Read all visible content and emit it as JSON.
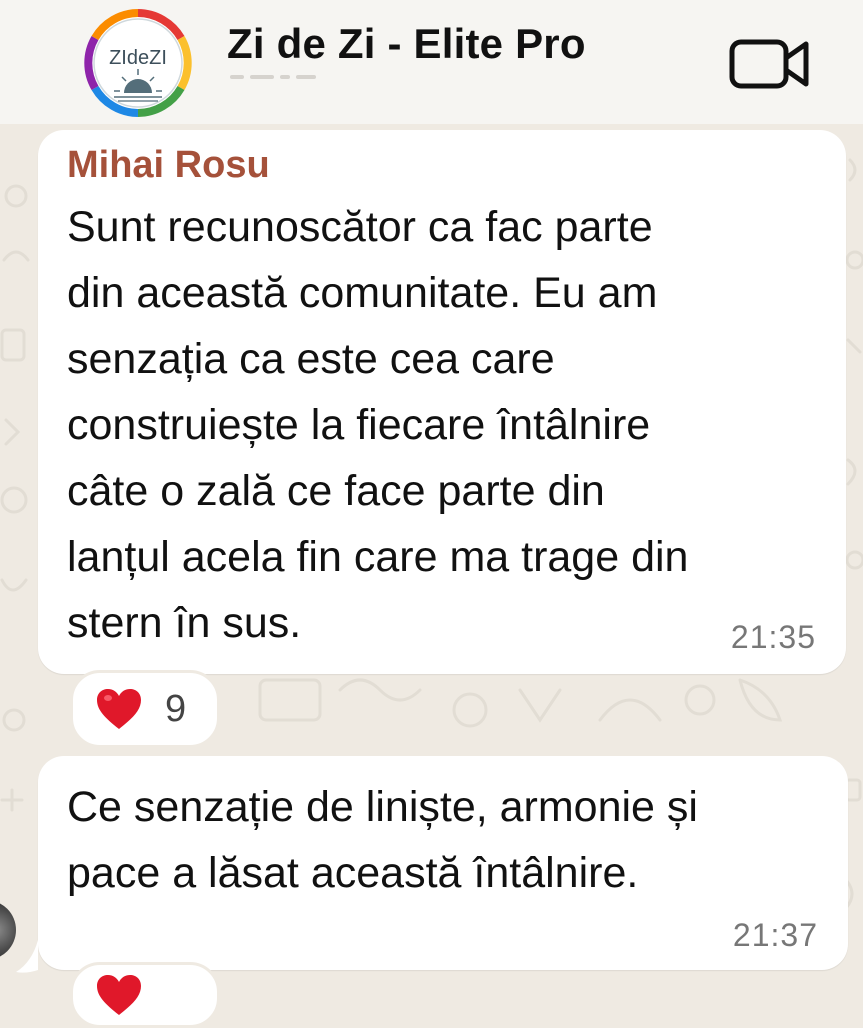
{
  "header": {
    "title": "Zi de Zi - Elite Pro",
    "avatar_text": "ZIdeZI",
    "video_icon": "video-call-icon"
  },
  "messages": [
    {
      "sender": "Mihai Rosu",
      "text": "Sunt recunoscător ca fac parte\ndin această comunitate. Eu am\nsenzația ca este cea care\nconstruiește la fiecare întâlnire\ncâte o zală ce face parte din\nlanțul acela fin care ma trage din\nstern în sus.",
      "time": "21:35",
      "reaction": {
        "emoji_icon": "heart-icon",
        "count": "9"
      }
    },
    {
      "text": "Ce senzație de liniște, armonie și\npace a lăsat această întâlnire.",
      "time": "21:37",
      "reaction": {
        "emoji_icon": "heart-icon"
      }
    }
  ],
  "colors": {
    "sender_name": "#a5513a",
    "background": "#efeae2",
    "heart": "#e0182a"
  }
}
